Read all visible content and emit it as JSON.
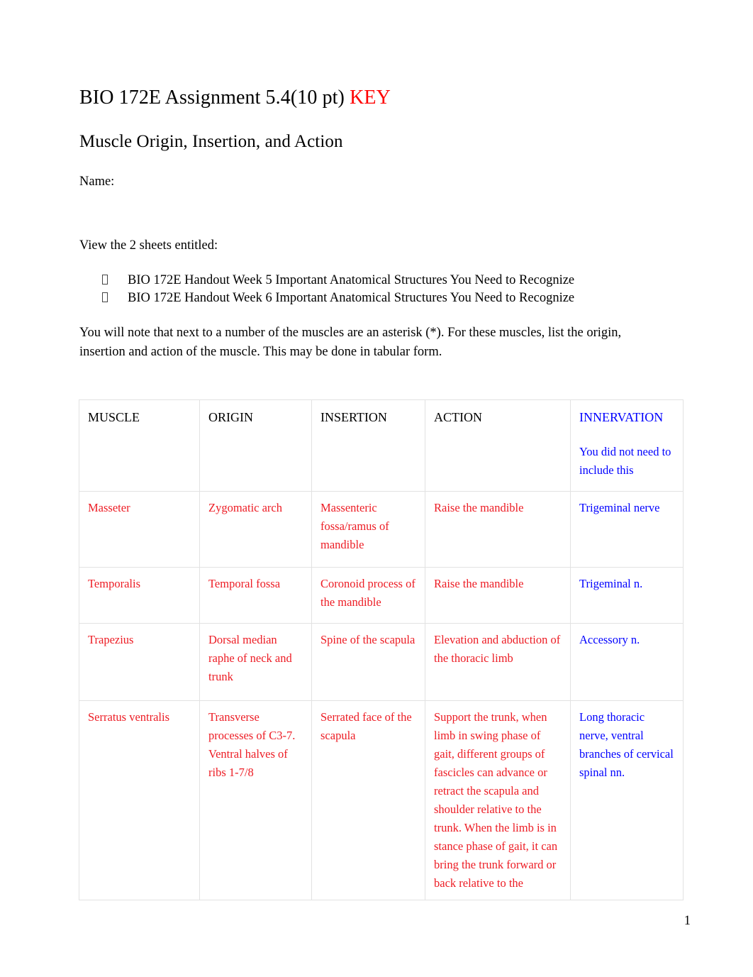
{
  "document": {
    "title_main": "BIO 172E Assignment 5.4(10 pt) ",
    "title_key": "KEY",
    "subtitle": "Muscle Origin, Insertion, and Action",
    "name_label": "Name:",
    "page_number": "1",
    "colors": {
      "answer_red": "#ED1C24",
      "title_key_red": "#FF0000",
      "innervation_blue": "#0000FF",
      "gridline_gray": "#E2E2E2"
    }
  },
  "instructions": {
    "view_sheets_intro": "View the 2 sheets entitled:",
    "bullets": [
      "BIO 172E Handout Week 5 Important Anatomical Structures You Need to Recognize",
      "BIO 172E Handout Week 6 Important Anatomical Structures You Need to Recognize"
    ],
    "asterisk_note": "You will note that next to a number of the muscles are an asterisk (*).    For these muscles, list the origin, insertion and action of the muscle.   This may be done in tabular form."
  },
  "table": {
    "headers": {
      "muscle": "MUSCLE",
      "origin": "ORIGIN",
      "insertion": "INSERTION",
      "action": "ACTION",
      "innervation": "INNERVATION",
      "innervation_note": "You did not need to include this"
    },
    "rows": [
      {
        "muscle": "Masseter",
        "origin": "Zygomatic arch",
        "insertion": "Massenteric fossa/ramus of mandible",
        "action": "Raise the mandible",
        "innervation": "Trigeminal nerve"
      },
      {
        "muscle": "Temporalis",
        "origin": "Temporal fossa",
        "insertion": "Coronoid process of the mandible",
        "action": "Raise the mandible",
        "innervation": "Trigeminal n."
      },
      {
        "muscle": "Trapezius",
        "origin": "Dorsal median raphe of neck and trunk",
        "insertion": "Spine of the scapula",
        "action": "Elevation and abduction of the thoracic limb",
        "innervation": "Accessory n."
      },
      {
        "muscle": "Serratus ventralis",
        "origin": "Transverse processes of C3-7. Ventral halves of ribs 1-7/8",
        "insertion": "Serrated face of the scapula",
        "action": "Support the trunk, when limb in swing phase of gait, different groups of fascicles can advance or retract the scapula and shoulder relative to the trunk. When the limb is in stance phase of gait, it can bring the trunk forward or back relative to the",
        "innervation": "Long thoracic nerve, ventral branches of cervical spinal nn."
      }
    ]
  }
}
